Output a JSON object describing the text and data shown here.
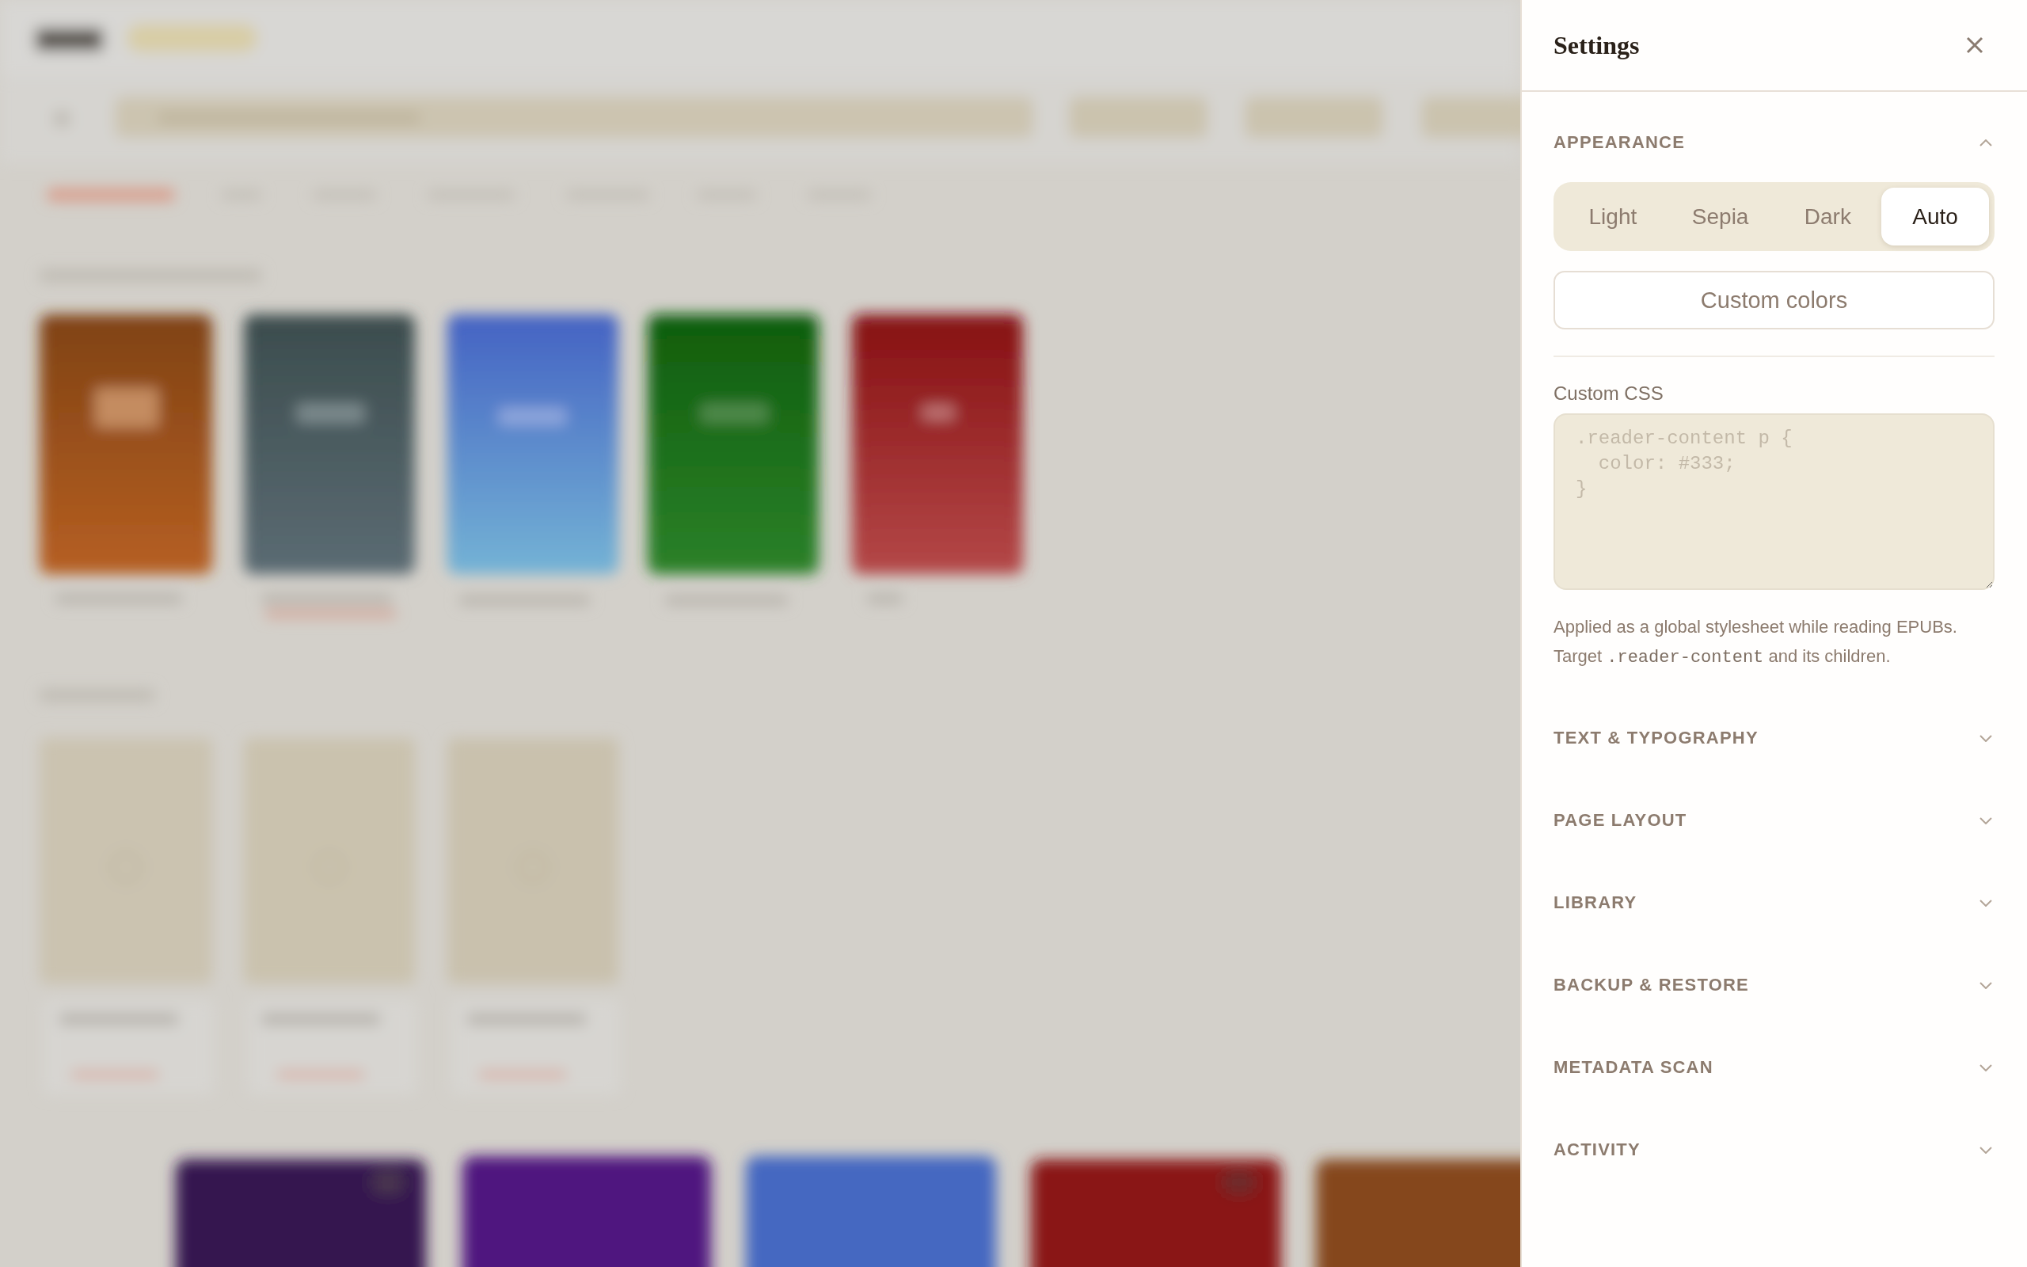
{
  "settings_panel": {
    "title": "Settings",
    "sections": [
      {
        "title": "APPEARANCE",
        "expanded": true,
        "content": {
          "theme_options": [
            {
              "label": "Light",
              "selected": false
            },
            {
              "label": "Sepia",
              "selected": false
            },
            {
              "label": "Dark",
              "selected": false
            },
            {
              "label": "Auto",
              "selected": true
            }
          ],
          "custom_colors_button": "Custom colors",
          "custom_css": {
            "label": "Custom CSS",
            "placeholder": ".reader-content p {\n  color: #333;\n}"
          },
          "help_text": [
            {
              "kind": "plain",
              "text": "Applied as a global stylesheet while reading EPUBs. Target "
            },
            {
              "kind": "code",
              "text": ".reader-content"
            },
            {
              "kind": "plain",
              "text": " and its children."
            }
          ]
        }
      },
      {
        "title": "TEXT & TYPOGRAPHY",
        "expanded": false
      },
      {
        "title": "PAGE LAYOUT",
        "expanded": false
      },
      {
        "title": "LIBRARY",
        "expanded": false
      },
      {
        "title": "BACKUP & RESTORE",
        "expanded": false
      },
      {
        "title": "METADATA SCAN",
        "expanded": false
      },
      {
        "title": "ACTIVITY",
        "expanded": false
      }
    ]
  }
}
